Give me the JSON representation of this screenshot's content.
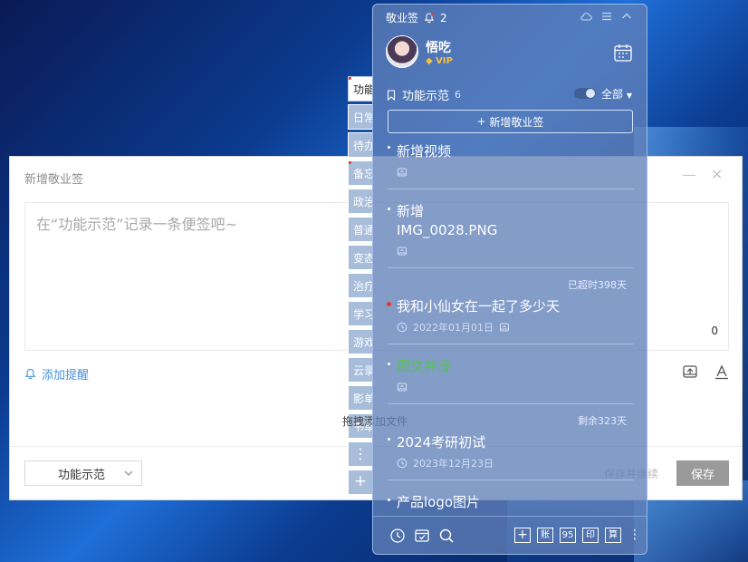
{
  "dialog": {
    "title": "新增敬业签",
    "placeholder": "在“功能示范”记录一条便签吧~",
    "char_count": "0",
    "remind_label": "添加提醒",
    "category": "功能示范",
    "save_continue": "保存并继续",
    "save": "保存"
  },
  "tabs": [
    "功能",
    "日常",
    "待办",
    "备忘",
    "政治",
    "普通",
    "变态",
    "治疗",
    "学习",
    "游戏",
    "云录",
    "影单",
    "书单"
  ],
  "drag_tip": "拖拽添加文件",
  "panel": {
    "app_name": "敬业签",
    "notif_count": "2",
    "user_name": "悟吃",
    "vip": "VIP",
    "folder_name": "功能示范",
    "folder_count": "6",
    "filter": "全部",
    "add_note": "新增敬业签",
    "notes": [
      {
        "title": "新增视频",
        "date": "",
        "status": ""
      },
      {
        "title": "新增 IMG_0028.PNG",
        "date": "",
        "status": ""
      },
      {
        "title": "我和小仙女在一起了多少天",
        "date": "2022年01月01日",
        "status": "已超时398天"
      },
      {
        "title": "图文并茂",
        "date": "",
        "status": ""
      },
      {
        "title": "2024考研初试",
        "date": "2023年12月23日",
        "status": "剩余323天"
      },
      {
        "title": "产品logo图片",
        "date": "",
        "status": ""
      }
    ],
    "footer_boxes": [
      "+",
      "账",
      "95",
      "印",
      "算"
    ]
  }
}
